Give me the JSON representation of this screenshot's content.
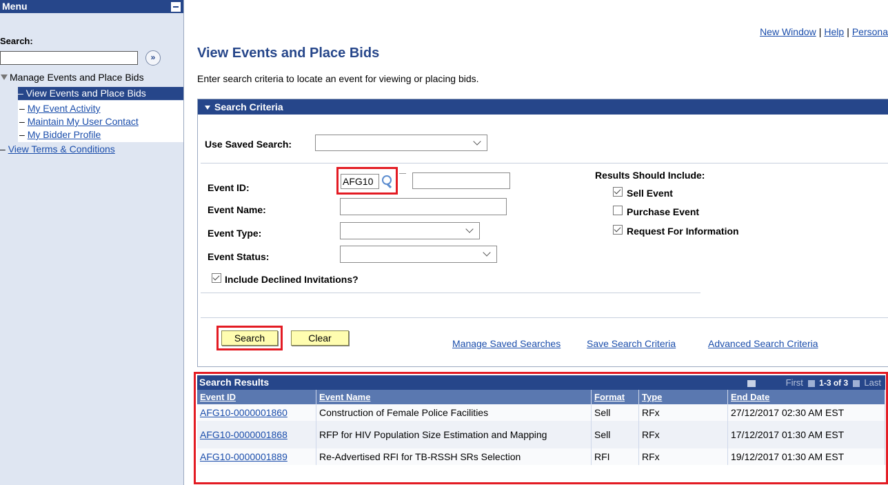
{
  "menu": {
    "title": "Menu",
    "search_label": "Search:",
    "search_value": "",
    "root_item": "Manage Events and Place Bids",
    "items": [
      {
        "label": "– View Events and Place Bids"
      },
      {
        "label": "My Event Activity"
      },
      {
        "label": "Maintain My User Contact"
      },
      {
        "label": "My Bidder Profile"
      }
    ],
    "terms": "View Terms & Conditions"
  },
  "top_links": {
    "new_window": "New Window",
    "help": "Help",
    "personalize": "Persona"
  },
  "page": {
    "title": "View Events and Place Bids",
    "instructions": "Enter search criteria to locate an event for viewing or placing bids."
  },
  "criteria": {
    "header": "Search Criteria",
    "saved_search_label": "Use Saved Search:",
    "saved_search_value": "",
    "event_id_label": "Event ID:",
    "event_id_value": "AFG10",
    "event_id_to_value": "",
    "event_name_label": "Event Name:",
    "event_type_label": "Event Type:",
    "event_status_label": "Event Status:",
    "include_declined_label": "Include Declined Invitations?",
    "include_declined_checked": true,
    "results_include_label": "Results Should Include:",
    "sell_event_label": "Sell Event",
    "sell_event_checked": true,
    "purchase_event_label": "Purchase Event",
    "purchase_event_checked": false,
    "rfi_label": "Request For Information",
    "rfi_checked": true,
    "search_button": "Search",
    "clear_button": "Clear",
    "manage_saved": "Manage Saved Searches",
    "save_criteria": "Save Search Criteria",
    "advanced": "Advanced Search Criteria"
  },
  "results": {
    "title": "Search Results",
    "nav_first": "First",
    "nav_range": "1-3 of 3",
    "nav_last": "Last",
    "columns": [
      "Event ID",
      "Event Name",
      "Format",
      "Type",
      "End Date"
    ],
    "rows": [
      {
        "event_id": "AFG10-0000001860",
        "event_name": "Construction of Female Police Facilities",
        "format": "Sell",
        "type": "RFx",
        "end_date": "27/12/2017 02:30 AM EST"
      },
      {
        "event_id": "AFG10-0000001868",
        "event_name": "RFP for HIV Population Size Estimation and Mapping",
        "format": "Sell",
        "type": "RFx",
        "end_date": "17/12/2017 01:30 AM EST"
      },
      {
        "event_id": "AFG10-0000001889",
        "event_name": "Re-Advertised RFI for TB-RSSH SRs Selection",
        "format": "RFI",
        "type": "RFx",
        "end_date": "19/12/2017 01:30 AM EST"
      }
    ]
  },
  "colors": {
    "header_blue": "#26468a",
    "button_yellow": "#fffdb0",
    "highlight_red": "#e31b23"
  }
}
